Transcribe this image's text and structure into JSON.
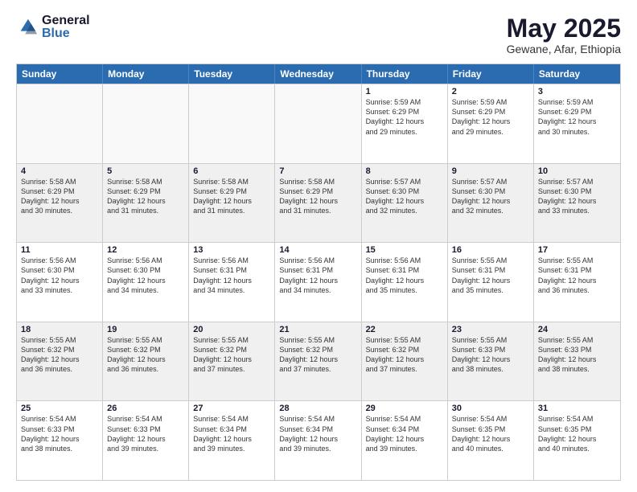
{
  "header": {
    "logo_general": "General",
    "logo_blue": "Blue",
    "month": "May 2025",
    "location": "Gewane, Afar, Ethiopia"
  },
  "days_of_week": [
    "Sunday",
    "Monday",
    "Tuesday",
    "Wednesday",
    "Thursday",
    "Friday",
    "Saturday"
  ],
  "weeks": [
    [
      {
        "day": "",
        "text": ""
      },
      {
        "day": "",
        "text": ""
      },
      {
        "day": "",
        "text": ""
      },
      {
        "day": "",
        "text": ""
      },
      {
        "day": "1",
        "text": "Sunrise: 5:59 AM\nSunset: 6:29 PM\nDaylight: 12 hours\nand 29 minutes."
      },
      {
        "day": "2",
        "text": "Sunrise: 5:59 AM\nSunset: 6:29 PM\nDaylight: 12 hours\nand 29 minutes."
      },
      {
        "day": "3",
        "text": "Sunrise: 5:59 AM\nSunset: 6:29 PM\nDaylight: 12 hours\nand 30 minutes."
      }
    ],
    [
      {
        "day": "4",
        "text": "Sunrise: 5:58 AM\nSunset: 6:29 PM\nDaylight: 12 hours\nand 30 minutes."
      },
      {
        "day": "5",
        "text": "Sunrise: 5:58 AM\nSunset: 6:29 PM\nDaylight: 12 hours\nand 31 minutes."
      },
      {
        "day": "6",
        "text": "Sunrise: 5:58 AM\nSunset: 6:29 PM\nDaylight: 12 hours\nand 31 minutes."
      },
      {
        "day": "7",
        "text": "Sunrise: 5:58 AM\nSunset: 6:29 PM\nDaylight: 12 hours\nand 31 minutes."
      },
      {
        "day": "8",
        "text": "Sunrise: 5:57 AM\nSunset: 6:30 PM\nDaylight: 12 hours\nand 32 minutes."
      },
      {
        "day": "9",
        "text": "Sunrise: 5:57 AM\nSunset: 6:30 PM\nDaylight: 12 hours\nand 32 minutes."
      },
      {
        "day": "10",
        "text": "Sunrise: 5:57 AM\nSunset: 6:30 PM\nDaylight: 12 hours\nand 33 minutes."
      }
    ],
    [
      {
        "day": "11",
        "text": "Sunrise: 5:56 AM\nSunset: 6:30 PM\nDaylight: 12 hours\nand 33 minutes."
      },
      {
        "day": "12",
        "text": "Sunrise: 5:56 AM\nSunset: 6:30 PM\nDaylight: 12 hours\nand 34 minutes."
      },
      {
        "day": "13",
        "text": "Sunrise: 5:56 AM\nSunset: 6:31 PM\nDaylight: 12 hours\nand 34 minutes."
      },
      {
        "day": "14",
        "text": "Sunrise: 5:56 AM\nSunset: 6:31 PM\nDaylight: 12 hours\nand 34 minutes."
      },
      {
        "day": "15",
        "text": "Sunrise: 5:56 AM\nSunset: 6:31 PM\nDaylight: 12 hours\nand 35 minutes."
      },
      {
        "day": "16",
        "text": "Sunrise: 5:55 AM\nSunset: 6:31 PM\nDaylight: 12 hours\nand 35 minutes."
      },
      {
        "day": "17",
        "text": "Sunrise: 5:55 AM\nSunset: 6:31 PM\nDaylight: 12 hours\nand 36 minutes."
      }
    ],
    [
      {
        "day": "18",
        "text": "Sunrise: 5:55 AM\nSunset: 6:32 PM\nDaylight: 12 hours\nand 36 minutes."
      },
      {
        "day": "19",
        "text": "Sunrise: 5:55 AM\nSunset: 6:32 PM\nDaylight: 12 hours\nand 36 minutes."
      },
      {
        "day": "20",
        "text": "Sunrise: 5:55 AM\nSunset: 6:32 PM\nDaylight: 12 hours\nand 37 minutes."
      },
      {
        "day": "21",
        "text": "Sunrise: 5:55 AM\nSunset: 6:32 PM\nDaylight: 12 hours\nand 37 minutes."
      },
      {
        "day": "22",
        "text": "Sunrise: 5:55 AM\nSunset: 6:32 PM\nDaylight: 12 hours\nand 37 minutes."
      },
      {
        "day": "23",
        "text": "Sunrise: 5:55 AM\nSunset: 6:33 PM\nDaylight: 12 hours\nand 38 minutes."
      },
      {
        "day": "24",
        "text": "Sunrise: 5:55 AM\nSunset: 6:33 PM\nDaylight: 12 hours\nand 38 minutes."
      }
    ],
    [
      {
        "day": "25",
        "text": "Sunrise: 5:54 AM\nSunset: 6:33 PM\nDaylight: 12 hours\nand 38 minutes."
      },
      {
        "day": "26",
        "text": "Sunrise: 5:54 AM\nSunset: 6:33 PM\nDaylight: 12 hours\nand 39 minutes."
      },
      {
        "day": "27",
        "text": "Sunrise: 5:54 AM\nSunset: 6:34 PM\nDaylight: 12 hours\nand 39 minutes."
      },
      {
        "day": "28",
        "text": "Sunrise: 5:54 AM\nSunset: 6:34 PM\nDaylight: 12 hours\nand 39 minutes."
      },
      {
        "day": "29",
        "text": "Sunrise: 5:54 AM\nSunset: 6:34 PM\nDaylight: 12 hours\nand 39 minutes."
      },
      {
        "day": "30",
        "text": "Sunrise: 5:54 AM\nSunset: 6:35 PM\nDaylight: 12 hours\nand 40 minutes."
      },
      {
        "day": "31",
        "text": "Sunrise: 5:54 AM\nSunset: 6:35 PM\nDaylight: 12 hours\nand 40 minutes."
      }
    ]
  ]
}
